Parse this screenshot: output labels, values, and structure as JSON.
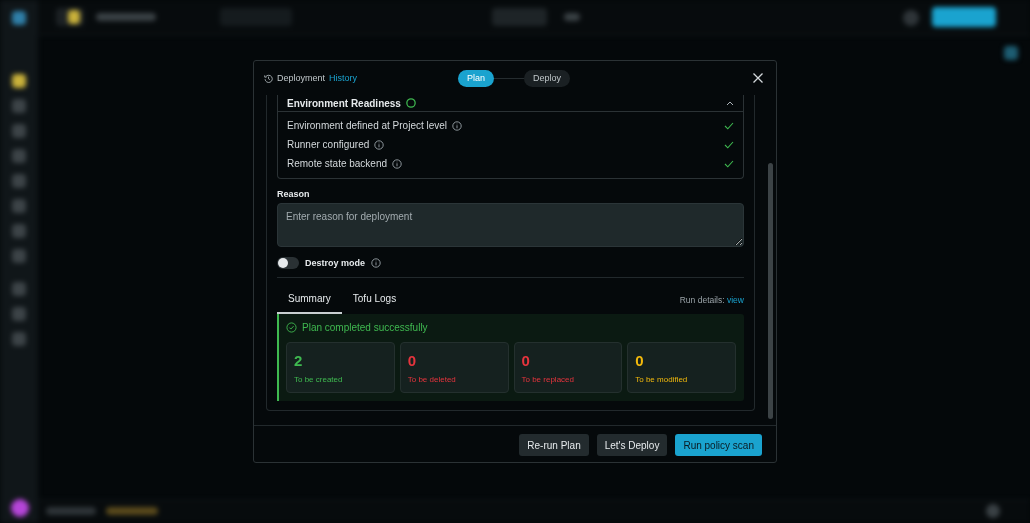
{
  "header": {
    "title": "Deployment",
    "link": "History"
  },
  "steps": [
    {
      "label": "Plan",
      "selected": true
    },
    {
      "label": "Deploy",
      "selected": false
    }
  ],
  "readiness": {
    "title": "Environment Readiness",
    "passed": true,
    "expanded": true,
    "items": [
      {
        "label": "Environment defined at Project level",
        "checked": true
      },
      {
        "label": "Runner configured",
        "checked": true
      },
      {
        "label": "Remote state backend",
        "checked": true
      }
    ]
  },
  "reason": {
    "label": "Reason",
    "placeholder": "Enter reason for deployment"
  },
  "destroy_mode": {
    "label": "Destroy mode",
    "on": false
  },
  "tabs": [
    {
      "label": "Summary",
      "selected": true
    },
    {
      "label": "Tofu Logs",
      "selected": false
    }
  ],
  "run_details": {
    "label": "Run details:",
    "link": "view"
  },
  "result": {
    "message": "Plan completed successfully",
    "stats": [
      {
        "value": "2",
        "label": "To be created",
        "color": "#3fb950"
      },
      {
        "value": "0",
        "label": "To be deleted",
        "color": "#e5343d"
      },
      {
        "value": "0",
        "label": "To be replaced",
        "color": "#e5343d"
      },
      {
        "value": "0",
        "label": "To be modified",
        "color": "#f2b90c"
      }
    ]
  },
  "buttons": [
    {
      "label": "Re-run Plan",
      "kind": "secondary"
    },
    {
      "label": "Let's Deploy",
      "kind": "secondary"
    },
    {
      "label": "Run policy scan",
      "kind": "primary"
    }
  ]
}
